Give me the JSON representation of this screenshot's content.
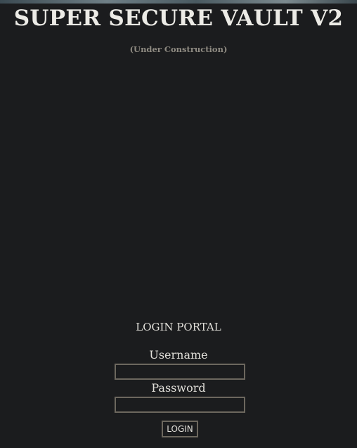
{
  "header": {
    "title": "SUPER SECURE VAULT V2",
    "subtitle": "(Under Construction)"
  },
  "login": {
    "portal_title": "LOGIN PORTAL",
    "username_label": "Username",
    "username_value": "",
    "password_label": "Password",
    "password_value": "",
    "button_label": "LOGIN"
  },
  "colors": {
    "background": "#1b1c1e",
    "text": "#e2e0da",
    "muted": "#8f8b82",
    "border": "#6c675e"
  }
}
